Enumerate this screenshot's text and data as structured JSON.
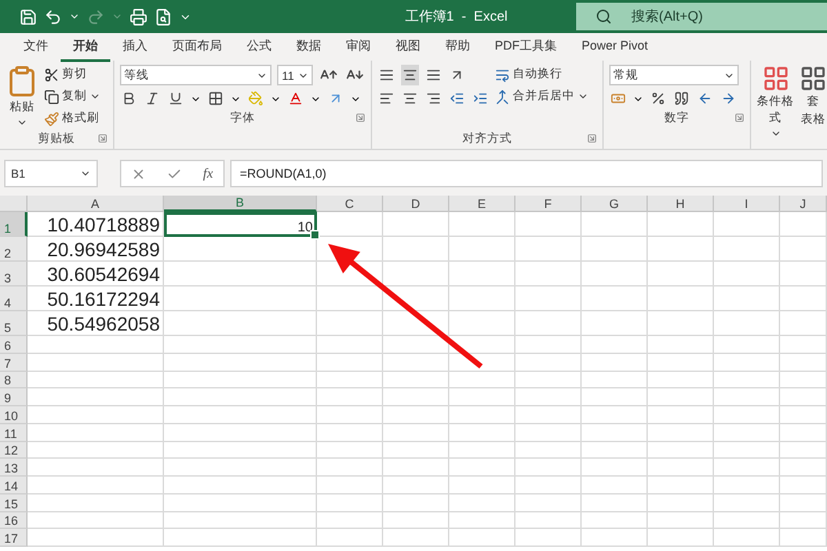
{
  "title_bar": {
    "title": "工作簿1  -  Excel",
    "search": {
      "placeholder": "搜索(Alt+Q)"
    }
  },
  "tabs": [
    {
      "label": "文件",
      "selected": false
    },
    {
      "label": "开始",
      "selected": true
    },
    {
      "label": "插入",
      "selected": false
    },
    {
      "label": "页面布局",
      "selected": false
    },
    {
      "label": "公式",
      "selected": false
    },
    {
      "label": "数据",
      "selected": false
    },
    {
      "label": "审阅",
      "selected": false
    },
    {
      "label": "视图",
      "selected": false
    },
    {
      "label": "帮助",
      "selected": false
    },
    {
      "label": "PDF工具集",
      "selected": false
    },
    {
      "label": "Power Pivot",
      "selected": false
    }
  ],
  "ribbon": {
    "clipboard": {
      "paste": "粘贴",
      "cut": "剪切",
      "copy": "复制",
      "format_painter": "格式刷",
      "label": "剪贴板"
    },
    "font": {
      "font_name": "等线",
      "font_size": "11",
      "label": "字体"
    },
    "alignment": {
      "wrap_text": "自动换行",
      "merge_center": "合并后居中",
      "label": "对齐方式"
    },
    "number": {
      "format": "常规",
      "label": "数字"
    },
    "styles": {
      "conditional_formatting": "条件格式",
      "table_format_lines": [
        "套",
        "表格"
      ]
    }
  },
  "formula_bar": {
    "name_box": "B1",
    "fx": "fx",
    "formula": "=ROUND(A1,0)"
  },
  "sheet": {
    "columns": [
      {
        "label": "A",
        "selected": false
      },
      {
        "label": "B",
        "selected": true
      },
      {
        "label": "C",
        "selected": false
      },
      {
        "label": "D",
        "selected": false
      },
      {
        "label": "E",
        "selected": false
      },
      {
        "label": "F",
        "selected": false
      },
      {
        "label": "G",
        "selected": false
      },
      {
        "label": "H",
        "selected": false
      },
      {
        "label": "I",
        "selected": false
      },
      {
        "label": "J",
        "selected": false
      }
    ],
    "rows": [
      {
        "label": "1",
        "selected": true,
        "cells": [
          {
            "text": "10.40718889",
            "active": false
          },
          {
            "text": "10",
            "active": true
          }
        ]
      },
      {
        "label": "2",
        "selected": false,
        "cells": [
          {
            "text": "20.96942589",
            "active": false
          }
        ]
      },
      {
        "label": "3",
        "selected": false,
        "cells": [
          {
            "text": "30.60542694",
            "active": false
          }
        ]
      },
      {
        "label": "4",
        "selected": false,
        "cells": [
          {
            "text": "50.16172294",
            "active": false
          }
        ]
      },
      {
        "label": "5",
        "selected": false,
        "cells": [
          {
            "text": "50.54962058",
            "active": false
          }
        ]
      },
      {
        "label": "6",
        "selected": false,
        "cells": []
      },
      {
        "label": "7",
        "selected": false,
        "cells": []
      },
      {
        "label": "8",
        "selected": false,
        "cells": []
      },
      {
        "label": "9",
        "selected": false,
        "cells": []
      },
      {
        "label": "10",
        "selected": false,
        "cells": []
      },
      {
        "label": "11",
        "selected": false,
        "cells": []
      },
      {
        "label": "12",
        "selected": false,
        "cells": []
      },
      {
        "label": "13",
        "selected": false,
        "cells": []
      },
      {
        "label": "14",
        "selected": false,
        "cells": []
      },
      {
        "label": "15",
        "selected": false,
        "cells": []
      },
      {
        "label": "16",
        "selected": false,
        "cells": []
      },
      {
        "label": "17",
        "selected": false,
        "cells": []
      }
    ]
  }
}
